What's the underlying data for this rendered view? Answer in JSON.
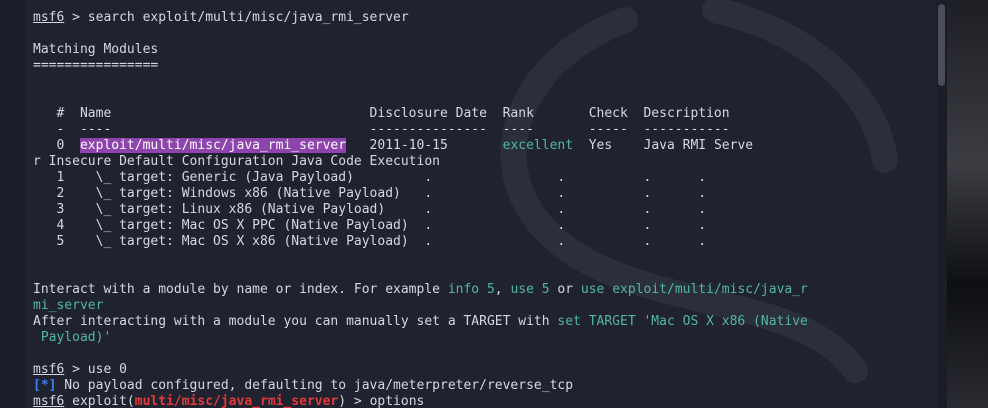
{
  "terminal": {
    "lines": [
      {
        "segments": [
          {
            "t": "msf6",
            "u": true
          },
          {
            "t": " > search exploit/multi/misc/java_rmi_server"
          }
        ]
      },
      {
        "segments": []
      },
      {
        "segments": [
          {
            "t": "Matching Modules"
          }
        ]
      },
      {
        "segments": [
          {
            "t": "================"
          }
        ]
      },
      {
        "segments": []
      },
      {
        "segments": []
      },
      {
        "segments": [
          {
            "t": "   #  Name                                 Disclosure Date  Rank       Check  Description"
          }
        ]
      },
      {
        "segments": [
          {
            "t": "   -  ----                                 ---------------  ----       -----  -----------"
          }
        ]
      },
      {
        "segments": [
          {
            "t": "   0  "
          },
          {
            "t": "exploit/multi/misc/java_rmi_server",
            "c": "hl"
          },
          {
            "t": "   2011-10-15       "
          },
          {
            "t": "excellent",
            "c": "green"
          },
          {
            "t": "  Yes    Java RMI Serve"
          }
        ]
      },
      {
        "segments": [
          {
            "t": "r Insecure Default Configuration Java Code Execution"
          }
        ]
      },
      {
        "segments": [
          {
            "t": "   1    \\_ target: Generic (Java Payload)         .                .          .      ."
          }
        ]
      },
      {
        "segments": [
          {
            "t": "   2    \\_ target: Windows x86 (Native Payload)   .                .          .      ."
          }
        ]
      },
      {
        "segments": [
          {
            "t": "   3    \\_ target: Linux x86 (Native Payload)     .                .          .      ."
          }
        ]
      },
      {
        "segments": [
          {
            "t": "   4    \\_ target: Mac OS X PPC (Native Payload)  .                .          .      ."
          }
        ]
      },
      {
        "segments": [
          {
            "t": "   5    \\_ target: Mac OS X x86 (Native Payload)  .                .          .      ."
          }
        ]
      },
      {
        "segments": []
      },
      {
        "segments": []
      },
      {
        "segments": [
          {
            "t": "Interact with a module by name or index. For example "
          },
          {
            "t": "info 5",
            "c": "green"
          },
          {
            "t": ", "
          },
          {
            "t": "use 5",
            "c": "green"
          },
          {
            "t": " or "
          },
          {
            "t": "use exploit/multi/misc/java_r",
            "c": "green"
          }
        ]
      },
      {
        "segments": [
          {
            "t": "mi_server",
            "c": "green"
          }
        ]
      },
      {
        "segments": [
          {
            "t": "After interacting with a module you can manually set a TARGET with "
          },
          {
            "t": "set TARGET 'Mac OS X x86 (Native",
            "c": "green"
          }
        ]
      },
      {
        "segments": [
          {
            "t": " Payload)'",
            "c": "green"
          }
        ]
      },
      {
        "segments": []
      },
      {
        "segments": [
          {
            "t": "msf6",
            "u": true
          },
          {
            "t": " > use 0"
          }
        ]
      },
      {
        "segments": [
          {
            "t": "[*]",
            "c": "blue"
          },
          {
            "t": " No payload configured, defaulting to java/meterpreter/reverse_tcp"
          }
        ]
      },
      {
        "segments": [
          {
            "t": "msf6",
            "u": true
          },
          {
            "t": " exploit("
          },
          {
            "t": "multi/misc/java_rmi_server",
            "c": "red"
          },
          {
            "t": ") > options"
          }
        ]
      }
    ]
  }
}
